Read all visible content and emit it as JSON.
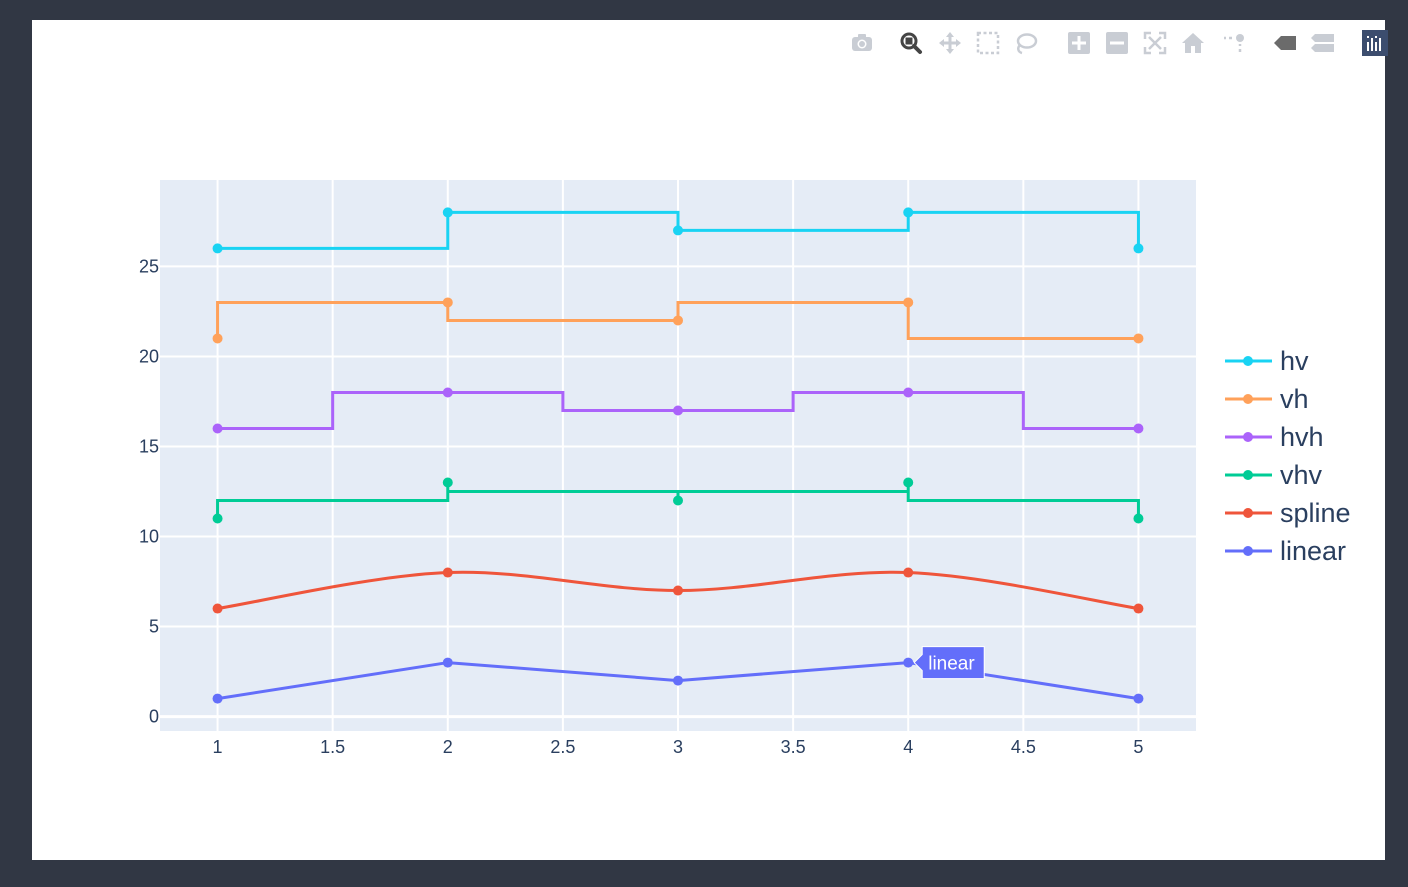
{
  "modebar": {
    "buttons": [
      {
        "name": "camera-icon",
        "title": "Download plot as a png"
      },
      {
        "name": "zoom-icon",
        "title": "Zoom",
        "active": true
      },
      {
        "name": "pan-icon",
        "title": "Pan"
      },
      {
        "name": "box-select-icon",
        "title": "Box Select"
      },
      {
        "name": "lasso-select-icon",
        "title": "Lasso Select"
      },
      {
        "name": "zoom-in-icon",
        "title": "Zoom in"
      },
      {
        "name": "zoom-out-icon",
        "title": "Zoom out"
      },
      {
        "name": "autoscale-icon",
        "title": "Autoscale"
      },
      {
        "name": "reset-axes-icon",
        "title": "Reset axes"
      },
      {
        "name": "spike-lines-icon",
        "title": "Toggle Spike Lines"
      },
      {
        "name": "hover-closest-icon",
        "title": "Show closest data on hover"
      },
      {
        "name": "hover-compare-icon",
        "title": "Compare data on hover"
      },
      {
        "name": "plotly-logo-icon",
        "title": "Produced with Plotly"
      }
    ]
  },
  "chart_data": {
    "type": "line",
    "title": "",
    "xlabel": "",
    "ylabel": "",
    "x": [
      1,
      2,
      3,
      4,
      5
    ],
    "xlim": [
      0.75,
      5.25
    ],
    "ylim": [
      -0.8,
      29.8
    ],
    "xticks": [
      "1",
      "1.5",
      "2",
      "2.5",
      "3",
      "3.5",
      "4",
      "4.5",
      "5"
    ],
    "yticks": [
      "0",
      "5",
      "10",
      "15",
      "20",
      "25"
    ],
    "grid": true,
    "legend_position": "right",
    "plot_background": "#e5ecf6",
    "series": [
      {
        "name": "linear",
        "shape": "linear",
        "color": "#636efa",
        "values": [
          1,
          3,
          2,
          3,
          1
        ]
      },
      {
        "name": "spline",
        "shape": "spline",
        "color": "#ef553b",
        "values": [
          6,
          8,
          7,
          8,
          6
        ]
      },
      {
        "name": "vhv",
        "shape": "vhv",
        "color": "#00cc96",
        "values": [
          11,
          13,
          12,
          13,
          11
        ]
      },
      {
        "name": "hvh",
        "shape": "hvh",
        "color": "#ab63fa",
        "values": [
          16,
          18,
          17,
          18,
          16
        ]
      },
      {
        "name": "vh",
        "shape": "vh",
        "color": "#ffa15a",
        "values": [
          21,
          23,
          22,
          23,
          21
        ]
      },
      {
        "name": "hv",
        "shape": "hv",
        "color": "#19d3f3",
        "values": [
          26,
          28,
          27,
          28,
          26
        ]
      }
    ],
    "legend_order": [
      "hv",
      "vh",
      "hvh",
      "vhv",
      "spline",
      "linear"
    ],
    "hover": {
      "series": "linear",
      "x": 4,
      "y": 3,
      "label": "linear"
    }
  }
}
